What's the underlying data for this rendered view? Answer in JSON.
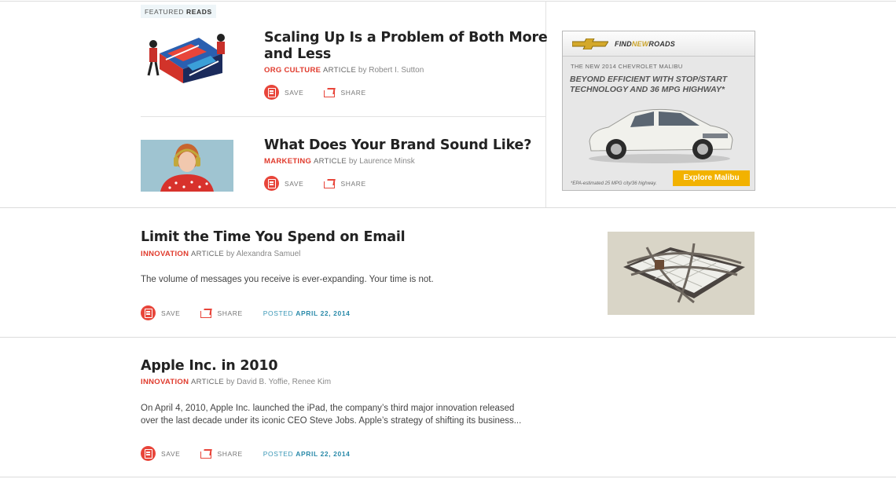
{
  "featured": {
    "label_prefix": "FEATURED",
    "label_bold": "READS",
    "items": [
      {
        "title_line1": "Scaling Up Is a Problem of Both More",
        "title_line2": "and Less",
        "topic": "ORG CULTURE",
        "type": "ARTICLE",
        "by": "by",
        "author": "Robert I. Sutton",
        "thumb_icon": "scaling-illustration"
      },
      {
        "title_line1": "What Does Your Brand Sound Like?",
        "topic": "MARKETING",
        "type": "ARTICLE",
        "by": "by",
        "author": "Laurence Minsk",
        "thumb_icon": "headphones-portrait"
      }
    ]
  },
  "actions": {
    "save": "SAVE",
    "share": "SHARE",
    "save_icon": "save-icon",
    "share_icon": "share-icon"
  },
  "ad": {
    "brand_tagline_1": "FIND",
    "brand_tagline_2": "NEW",
    "brand_tagline_3": "ROADS",
    "subtitle": "THE NEW 2014 CHEVROLET MALIBU",
    "headline_1": "BEYOND EFFICIENT WITH STOP/START",
    "headline_2": "TECHNOLOGY AND 36 MPG HIGHWAY",
    "headline_mark": "*",
    "fine_print": "*EPA-estimated 25 MPG city/36 highway.",
    "cta": "Explore Malibu",
    "cta_color": "#f2b200"
  },
  "articles": [
    {
      "title": "Limit the Time You Spend on Email",
      "topic": "INNOVATION",
      "type": "ARTICLE",
      "by": "by",
      "authors": "Alexandra Samuel",
      "excerpt_1": "The volume of messages you receive is ever-expanding. Your time is not.",
      "posted_label": "POSTED",
      "posted_date": "APRIL 22, 2014",
      "thumb_icon": "chained-keyboard"
    },
    {
      "title": "Apple Inc. in 2010",
      "topic": "INNOVATION",
      "type": "ARTICLE",
      "by": "by",
      "authors": "David B. Yoffie, Renee Kim",
      "excerpt_1": "On April 4, 2010, Apple Inc. launched the iPad, the company’s third major innovation released",
      "excerpt_2": "over the last decade under its iconic CEO Steve Jobs. Apple’s strategy of shifting its business...",
      "posted_label": "POSTED",
      "posted_date": "APRIL 22, 2014"
    }
  ],
  "colors": {
    "accent_red": "#e03a2c",
    "link_blue": "#2a8aa9"
  }
}
